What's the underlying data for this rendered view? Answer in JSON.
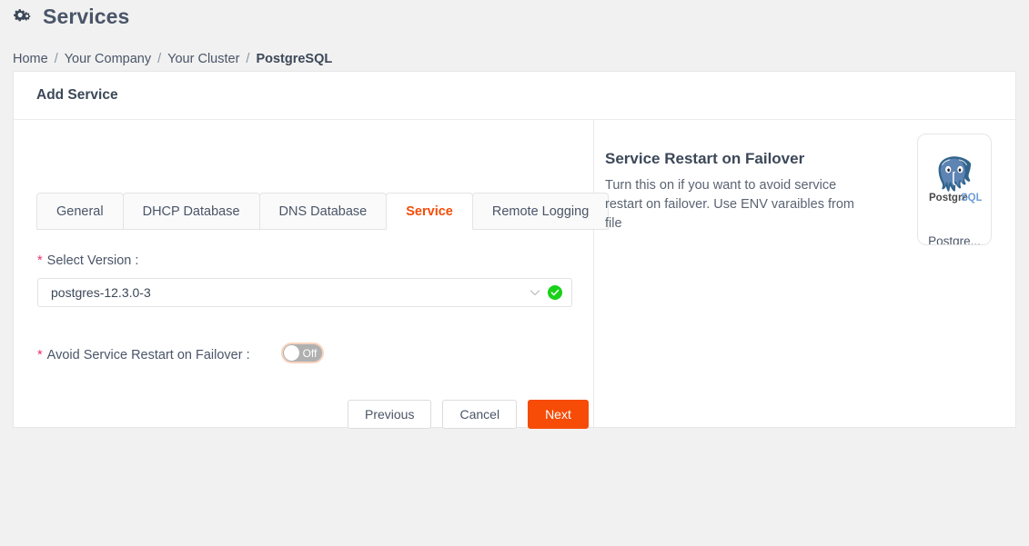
{
  "header": {
    "title": "Services",
    "icon": "cogs-icon"
  },
  "breadcrumb": {
    "separator": "/",
    "items": [
      {
        "label": "Home",
        "current": false
      },
      {
        "label": "Your Company",
        "current": false
      },
      {
        "label": "Your Cluster",
        "current": false
      },
      {
        "label": "PostgreSQL",
        "current": true
      }
    ]
  },
  "card": {
    "title": "Add Service"
  },
  "tabs": [
    {
      "label": "General",
      "active": false
    },
    {
      "label": "DHCP Database",
      "active": false
    },
    {
      "label": "DNS Database",
      "active": false
    },
    {
      "label": "Service",
      "active": true
    },
    {
      "label": "Remote Logging",
      "active": false
    }
  ],
  "form": {
    "required_marker": "*",
    "version": {
      "label": "Select Version :",
      "value": "postgres-12.3.0-3",
      "chevron_icon": "chevron-down-icon",
      "status_icon": "check-circle-icon"
    },
    "avoid_restart": {
      "label": "Avoid Service Restart on Failover :",
      "state_text": "Off",
      "on": false
    }
  },
  "buttons": {
    "previous": "Previous",
    "cancel": "Cancel",
    "next": "Next"
  },
  "info": {
    "title": "Service Restart on Failover",
    "text": "Turn this on if you want to avoid service restart on failover. Use ENV varaibles from file"
  },
  "logo": {
    "caption": "Postgre...",
    "wordmark_left": "Postgre",
    "wordmark_right": "SQL",
    "icon": "postgresql-elephant-icon"
  },
  "colors": {
    "accent": "#f64c08",
    "required": "#e8336d",
    "success": "#19d119",
    "page_bg": "#f1f1f1",
    "text": "#4a5568"
  }
}
